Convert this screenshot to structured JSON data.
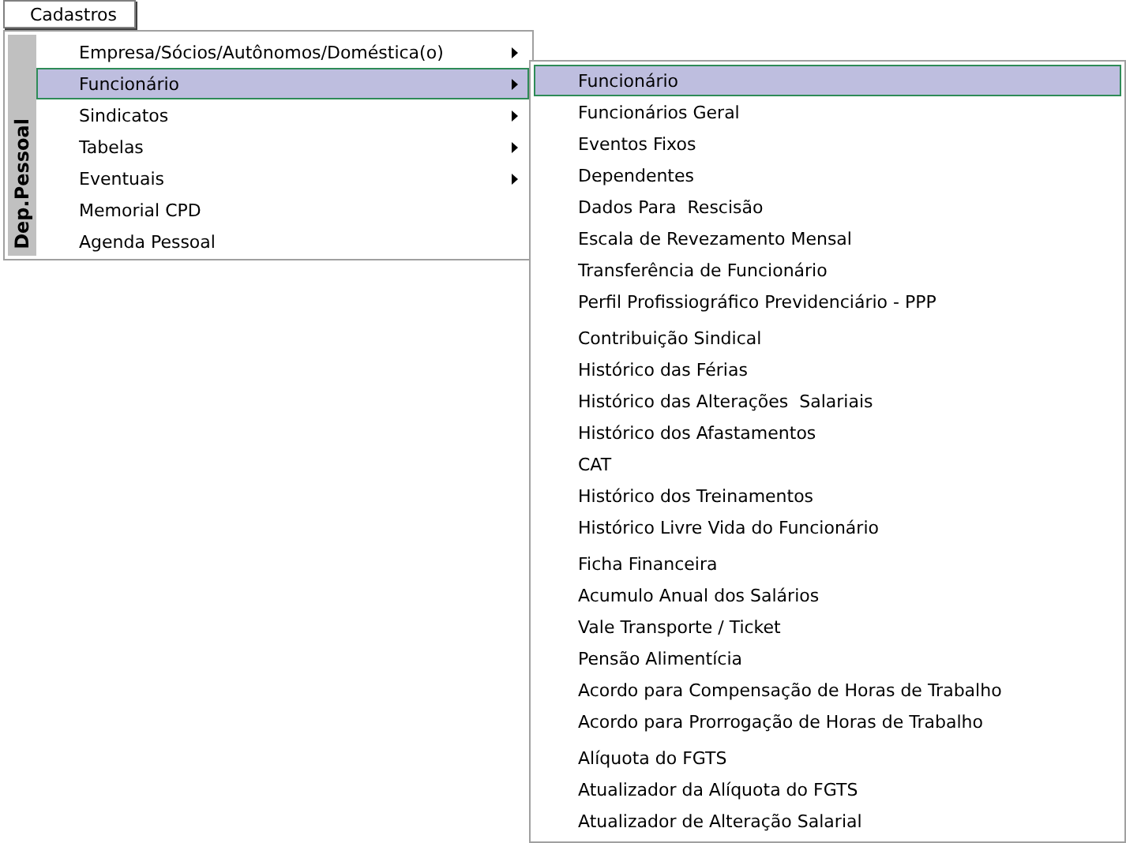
{
  "menu_bar": {
    "label": "Cadastros"
  },
  "menu": {
    "band_label": "Dep.Pessoal",
    "items": [
      {
        "label": "Empresa/Sócios/Autônomos/Doméstica(o)",
        "selected": false,
        "has_submenu": true
      },
      {
        "label": "Funcionário",
        "selected": true,
        "has_submenu": true
      },
      {
        "label": "Sindicatos",
        "selected": false,
        "has_submenu": true
      },
      {
        "label": "Tabelas",
        "selected": false,
        "has_submenu": true
      },
      {
        "label": "Eventuais",
        "selected": false,
        "has_submenu": true
      },
      {
        "label": "Memorial CPD",
        "selected": false,
        "has_submenu": false
      },
      {
        "label": "Agenda Pessoal",
        "selected": false,
        "has_submenu": false
      }
    ]
  },
  "submenu": {
    "groups": [
      {
        "items": [
          {
            "label": "Funcionário",
            "selected": true
          },
          {
            "label": "Funcionários Geral",
            "selected": false
          },
          {
            "label": "Eventos Fixos",
            "selected": false
          },
          {
            "label": "Dependentes",
            "selected": false
          },
          {
            "label": "Dados Para  Rescisão",
            "selected": false
          },
          {
            "label": "Escala de Revezamento Mensal",
            "selected": false
          },
          {
            "label": "Transferência de Funcionário",
            "selected": false
          },
          {
            "label": "Perfil Profissiográfico Previdenciário - PPP",
            "selected": false
          }
        ]
      },
      {
        "items": [
          {
            "label": "Contribuição Sindical",
            "selected": false
          },
          {
            "label": "Histórico das Férias",
            "selected": false
          },
          {
            "label": "Histórico das Alterações  Salariais",
            "selected": false
          },
          {
            "label": "Histórico dos Afastamentos",
            "selected": false
          },
          {
            "label": "CAT",
            "selected": false
          },
          {
            "label": "Histórico dos Treinamentos",
            "selected": false
          },
          {
            "label": "Histórico Livre Vida do Funcionário",
            "selected": false
          }
        ]
      },
      {
        "items": [
          {
            "label": "Ficha Financeira",
            "selected": false
          },
          {
            "label": "Acumulo Anual dos Salários",
            "selected": false
          },
          {
            "label": "Vale Transporte / Ticket",
            "selected": false
          },
          {
            "label": "Pensão Alimentícia",
            "selected": false
          },
          {
            "label": "Acordo para Compensação de Horas de Trabalho",
            "selected": false
          },
          {
            "label": "Acordo para Prorrogação de Horas de Trabalho",
            "selected": false
          }
        ]
      },
      {
        "items": [
          {
            "label": "Alíquota do FGTS",
            "selected": false
          },
          {
            "label": "Atualizador da Alíquota do FGTS",
            "selected": false
          },
          {
            "label": "Atualizador de Alteração Salarial",
            "selected": false
          }
        ]
      }
    ]
  }
}
